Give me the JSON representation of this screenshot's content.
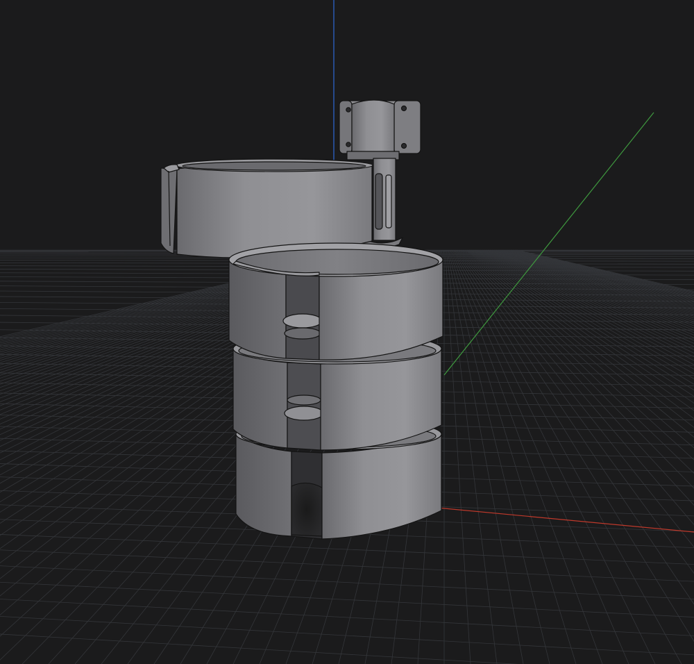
{
  "viewport": {
    "kind": "3d-model-viewport",
    "background": "#1b1b1c",
    "grid_color": "#34363a",
    "axes": {
      "x_color": "#c0392b",
      "y_color": "#3f9a3f",
      "z_color": "#2f6ad8"
    },
    "model": {
      "parts": [
        "clamp-block",
        "hinge-post",
        "swing-cup",
        "stack-tier-top",
        "stack-tier-middle",
        "stack-tier-bottom"
      ],
      "body_color": "#8a8a8e",
      "edge_color": "#141414"
    }
  }
}
